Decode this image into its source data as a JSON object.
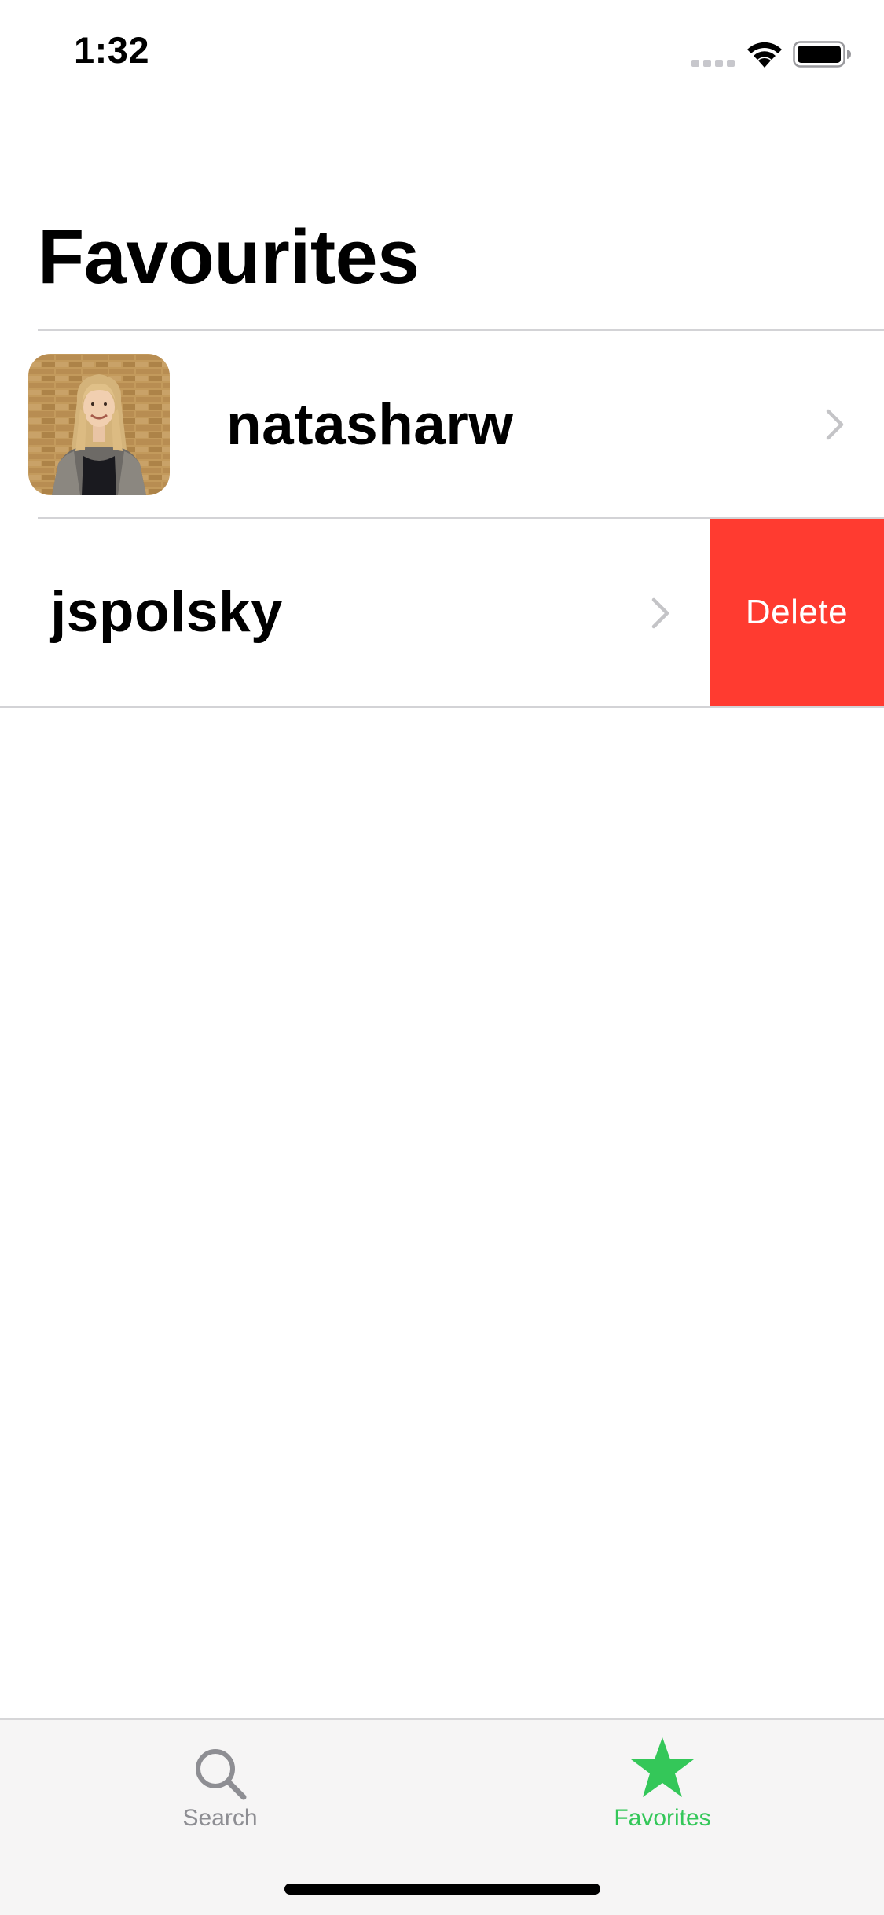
{
  "status_bar": {
    "time": "1:32"
  },
  "page": {
    "title": "Favourites"
  },
  "favorites": [
    {
      "username": "natasharw",
      "has_avatar": true
    },
    {
      "username": "jspolsky",
      "has_avatar": false
    }
  ],
  "swipe_actions": {
    "delete_label": "Delete"
  },
  "tab_bar": {
    "tabs": [
      {
        "label": "Search",
        "icon": "search-icon",
        "selected": false
      },
      {
        "label": "Favorites",
        "icon": "star-icon",
        "selected": true
      }
    ]
  },
  "colors": {
    "accent": "#34c759",
    "delete": "#ff3b30",
    "tab_inactive": "#8e8e93",
    "chevron": "#c4c4c7"
  }
}
